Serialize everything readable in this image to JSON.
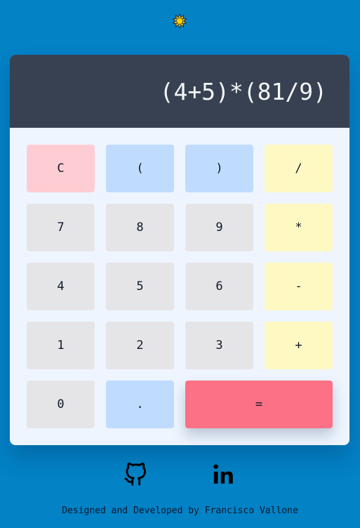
{
  "theme_toggle": {
    "icon": "sun-icon",
    "color": "#facc15"
  },
  "display": {
    "expression": "(4+5)*(81/9)"
  },
  "keys": [
    {
      "label": "C",
      "kind": "clear"
    },
    {
      "label": "(",
      "kind": "paren"
    },
    {
      "label": ")",
      "kind": "paren"
    },
    {
      "label": "/",
      "kind": "op"
    },
    {
      "label": "7",
      "kind": "num"
    },
    {
      "label": "8",
      "kind": "num"
    },
    {
      "label": "9",
      "kind": "num"
    },
    {
      "label": "*",
      "kind": "op"
    },
    {
      "label": "4",
      "kind": "num"
    },
    {
      "label": "5",
      "kind": "num"
    },
    {
      "label": "6",
      "kind": "num"
    },
    {
      "label": "-",
      "kind": "op"
    },
    {
      "label": "1",
      "kind": "num"
    },
    {
      "label": "2",
      "kind": "num"
    },
    {
      "label": "3",
      "kind": "num"
    },
    {
      "label": "+",
      "kind": "op"
    },
    {
      "label": "0",
      "kind": "num"
    },
    {
      "label": ".",
      "kind": "dot"
    },
    {
      "label": "=",
      "kind": "equals"
    }
  ],
  "socials": [
    {
      "icon": "github-icon"
    },
    {
      "icon": "linkedin-icon"
    }
  ],
  "footer": {
    "text": "Designed and Developed by Francisco Vallone"
  },
  "colors": {
    "background": "#0382c6",
    "display_bg": "#374151",
    "clear": "#fecdd3",
    "paren": "#bfdbfe",
    "operator": "#fef9c3",
    "number": "#e5e5e8",
    "equals": "#fb7185"
  }
}
